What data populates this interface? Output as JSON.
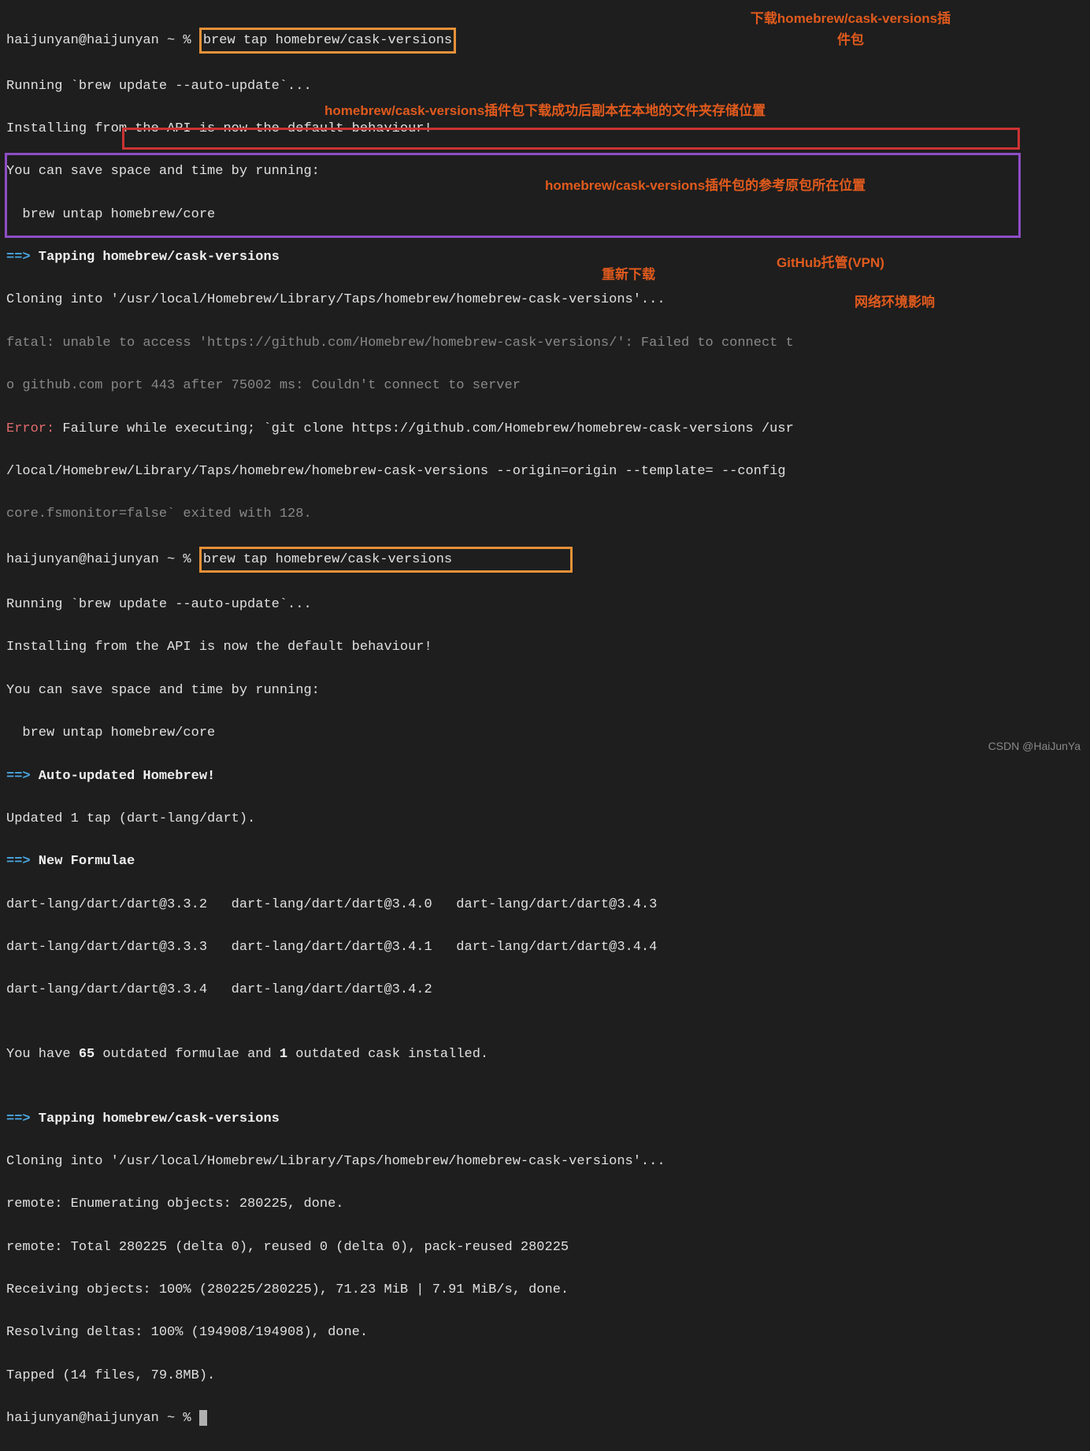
{
  "lines": {
    "l1_prompt": "haijunyan@haijunyan ~ % ",
    "l1_cmd": "brew tap homebrew/cask-versions",
    "l2": "Running `brew update --auto-update`...",
    "l3": "Installing from the API is now the default behaviour!",
    "l4": "You can save space and time by running:",
    "l5": "  brew untap homebrew/core",
    "l6_arrow": "==>",
    "l6_text": " Tapping homebrew/cask-versions",
    "l7": "Cloning into '/usr/local/Homebrew/Library/Taps/homebrew/homebrew-cask-versions'...",
    "l8": "fatal: unable to access 'https://github.com/Homebrew/homebrew-cask-versions/': Failed to connect t",
    "l9": "o github.com port 443 after 75002 ms: Couldn't connect to server",
    "l10_err": "Error:",
    "l10_text": " Failure while executing; `git clone https://github.com/Homebrew/homebrew-cask-versions /usr",
    "l11": "/local/Homebrew/Library/Taps/homebrew/homebrew-cask-versions --origin=origin --template= --config ",
    "l12": "core.fsmonitor=false` exited with 128.",
    "l13_prompt": "haijunyan@haijunyan ~ % ",
    "l13_cmd": "brew tap homebrew/cask-versions",
    "l14": "Running `brew update --auto-update`...",
    "l15": "Installing from the API is now the default behaviour!",
    "l16": "You can save space and time by running:",
    "l17": "  brew untap homebrew/core",
    "l18_arrow": "==>",
    "l18_text": " Auto-updated Homebrew!",
    "l19": "Updated 1 tap (dart-lang/dart).",
    "l20_arrow": "==>",
    "l20_text": " New Formulae",
    "l21": "dart-lang/dart/dart@3.3.2   dart-lang/dart/dart@3.4.0   dart-lang/dart/dart@3.4.3",
    "l22": "dart-lang/dart/dart@3.3.3   dart-lang/dart/dart@3.4.1   dart-lang/dart/dart@3.4.4",
    "l23": "dart-lang/dart/dart@3.3.4   dart-lang/dart/dart@3.4.2",
    "l24": "",
    "l25a": "You have ",
    "l25b": "65",
    "l25c": " outdated formulae and ",
    "l25d": "1",
    "l25e": " outdated cask installed.",
    "l26": "",
    "l27_arrow": "==>",
    "l27_text": " Tapping homebrew/cask-versions",
    "l28": "Cloning into '/usr/local/Homebrew/Library/Taps/homebrew/homebrew-cask-versions'...",
    "l29": "remote: Enumerating objects: 280225, done.",
    "l30": "remote: Total 280225 (delta 0), reused 0 (delta 0), pack-reused 280225",
    "l31": "Receiving objects: 100% (280225/280225), 71.23 MiB | 7.91 MiB/s, done.",
    "l32": "Resolving deltas: 100% (194908/194908), done.",
    "l33": "Tapped (14 files, 79.8MB).",
    "l34_prompt": "haijunyan@haijunyan ~ % "
  },
  "annotations": {
    "a1": "下载homebrew/cask-versions插",
    "a1b": "件包",
    "a2": "homebrew/cask-versions插件包下载成功后副本在本地的文件夹存储位置",
    "a3": "homebrew/cask-versions插件包的参考原包所在位置",
    "a4": "重新下载",
    "a5": "GitHub托管(VPN)",
    "a6": "网络环境影响"
  },
  "watermark": "CSDN @HaiJunYa"
}
